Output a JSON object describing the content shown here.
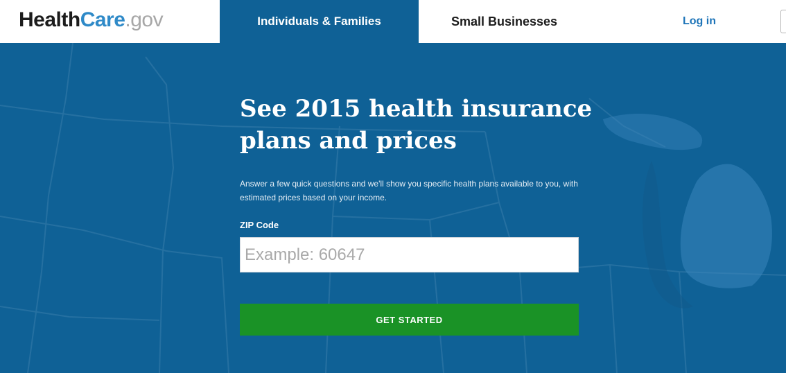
{
  "header": {
    "logo": {
      "part1": "Health",
      "part2": "Care",
      "part3": ".gov"
    },
    "tabs": [
      {
        "label": "Individuals & Families",
        "active": true
      },
      {
        "label": "Small Businesses",
        "active": false
      }
    ],
    "login_label": "Log in"
  },
  "hero": {
    "headline": "See 2015 health insurance plans and prices",
    "subtext": "Answer a few quick questions and we'll show you specific health plans available to you, with estimated prices based on your income.",
    "zip_label": "ZIP Code",
    "zip_placeholder": "Example: 60647",
    "zip_value": "",
    "button_label": "GET STARTED"
  },
  "colors": {
    "hero_background": "#0f6196",
    "button_green": "#1a9226",
    "link_blue": "#1d74b8"
  }
}
